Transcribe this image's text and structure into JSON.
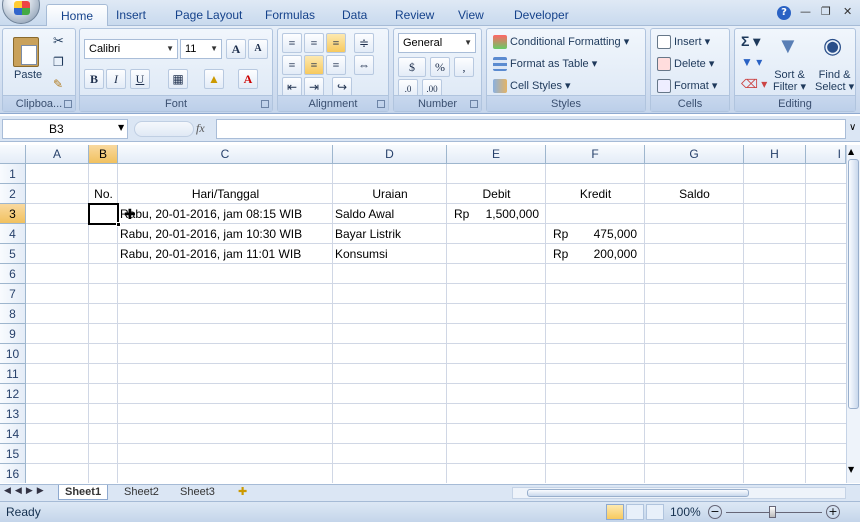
{
  "tabs": [
    "Home",
    "Insert",
    "Page Layout",
    "Formulas",
    "Data",
    "Review",
    "View",
    "Developer"
  ],
  "ribbon": {
    "clipboard": {
      "label": "Clipboa...",
      "paste": "Paste"
    },
    "font": {
      "label": "Font",
      "name": "Calibri",
      "size": "11",
      "bold": "B",
      "italic": "I",
      "underline": "U"
    },
    "alignment": {
      "label": "Alignment"
    },
    "number": {
      "label": "Number",
      "format": "General",
      "currency": "$",
      "percent": "%",
      "comma": ","
    },
    "styles": {
      "label": "Styles",
      "conditional": "Conditional Formatting",
      "table": "Format as Table",
      "cell_styles": "Cell Styles"
    },
    "cells": {
      "label": "Cells",
      "insert": "Insert",
      "delete": "Delete",
      "format": "Format"
    },
    "editing": {
      "label": "Editing",
      "sort": "Sort &",
      "filter": "Filter",
      "find": "Find &",
      "select": "Select"
    }
  },
  "formula_bar": {
    "name_box": "B3",
    "fx": "fx",
    "value": ""
  },
  "columns": [
    "A",
    "B",
    "C",
    "D",
    "E",
    "F",
    "G",
    "H",
    "I"
  ],
  "rows": [
    "1",
    "2",
    "3",
    "4",
    "5",
    "6",
    "7",
    "8",
    "9",
    "10",
    "11",
    "12",
    "13",
    "14",
    "15",
    "16"
  ],
  "table": {
    "headers": {
      "no": "No.",
      "tanggal": "Hari/Tanggal",
      "uraian": "Uraian",
      "debit": "Debit",
      "kredit": "Kredit",
      "saldo": "Saldo"
    },
    "rows": [
      {
        "tanggal": "Rabu, 20-01-2016, jam 08:15 WIB",
        "uraian": "Saldo Awal",
        "debit_cur": "Rp",
        "debit": "1,500,000",
        "kredit_cur": "",
        "kredit": ""
      },
      {
        "tanggal": "Rabu, 20-01-2016, jam 10:30 WIB",
        "uraian": "Bayar Listrik",
        "debit_cur": "",
        "debit": "",
        "kredit_cur": "Rp",
        "kredit": "475,000"
      },
      {
        "tanggal": "Rabu, 20-01-2016, jam 11:01 WIB",
        "uraian": "Konsumsi",
        "debit_cur": "",
        "debit": "",
        "kredit_cur": "Rp",
        "kredit": "200,000"
      }
    ]
  },
  "sheets": [
    "Sheet1",
    "Sheet2",
    "Sheet3"
  ],
  "status": {
    "ready": "Ready",
    "zoom": "100%"
  }
}
